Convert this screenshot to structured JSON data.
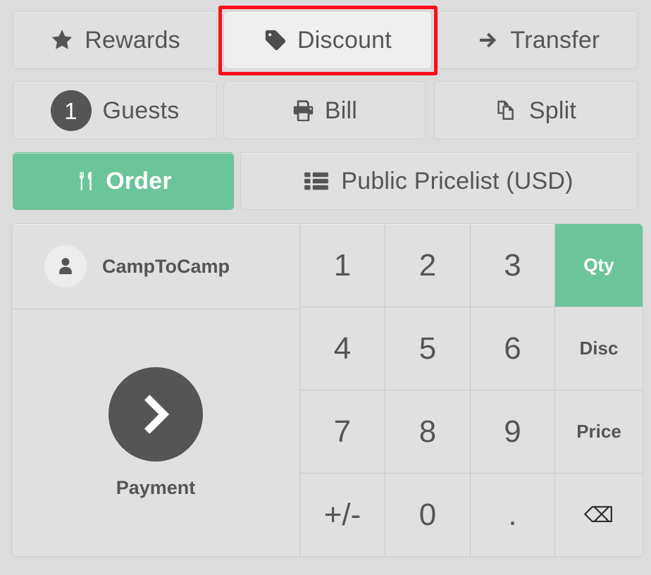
{
  "colors": {
    "page_background": "#dcdcdc",
    "button_background": "#e0e0e0",
    "button_selected_background": "#efefef",
    "accent_green": "#6cc49a",
    "text": "#555555",
    "selection_ring": "#fd0d1b"
  },
  "action_bar": {
    "row1": [
      {
        "name": "rewards",
        "label": "Rewards",
        "icon": "star-icon",
        "selected": false
      },
      {
        "name": "discount",
        "label": "Discount",
        "icon": "tag-icon",
        "selected": true
      },
      {
        "name": "transfer",
        "label": "Transfer",
        "icon": "arrow-right-icon",
        "selected": false
      }
    ],
    "row2": [
      {
        "name": "guests",
        "label": "Guests",
        "icon": "guest-count-badge",
        "count": "1",
        "selected": false
      },
      {
        "name": "bill",
        "label": "Bill",
        "icon": "printer-icon",
        "selected": false
      },
      {
        "name": "split",
        "label": "Split",
        "icon": "copy-icon",
        "selected": false
      }
    ],
    "row3": [
      {
        "name": "order",
        "label": "Order",
        "icon": "cutlery-icon",
        "active": true
      },
      {
        "name": "pricelist",
        "label": "Public Pricelist (USD)",
        "icon": "list-icon",
        "active": false
      }
    ]
  },
  "order_panel": {
    "customer": {
      "name": "CampToCamp",
      "icon": "person-icon"
    },
    "payment": {
      "label": "Payment",
      "icon": "chevron-right-icon"
    }
  },
  "numpad": {
    "keys": [
      {
        "name": "numpad-1",
        "label": "1",
        "type": "digit"
      },
      {
        "name": "numpad-2",
        "label": "2",
        "type": "digit"
      },
      {
        "name": "numpad-3",
        "label": "3",
        "type": "digit"
      },
      {
        "name": "numpad-qty",
        "label": "Qty",
        "type": "mode",
        "active": true
      },
      {
        "name": "numpad-4",
        "label": "4",
        "type": "digit"
      },
      {
        "name": "numpad-5",
        "label": "5",
        "type": "digit"
      },
      {
        "name": "numpad-6",
        "label": "6",
        "type": "digit"
      },
      {
        "name": "numpad-disc",
        "label": "Disc",
        "type": "mode",
        "active": false
      },
      {
        "name": "numpad-7",
        "label": "7",
        "type": "digit"
      },
      {
        "name": "numpad-8",
        "label": "8",
        "type": "digit"
      },
      {
        "name": "numpad-9",
        "label": "9",
        "type": "digit"
      },
      {
        "name": "numpad-price",
        "label": "Price",
        "type": "mode",
        "active": false
      },
      {
        "name": "numpad-plus-minus",
        "label": "+/-",
        "type": "digit"
      },
      {
        "name": "numpad-0",
        "label": "0",
        "type": "digit"
      },
      {
        "name": "numpad-decimal",
        "label": ".",
        "type": "digit"
      },
      {
        "name": "numpad-backspace",
        "label": "⌫",
        "type": "backspace"
      }
    ]
  }
}
